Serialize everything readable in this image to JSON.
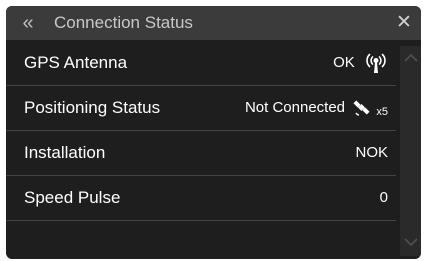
{
  "header": {
    "back_glyph": "«",
    "title": "Connection Status",
    "close_glyph": "✕"
  },
  "rows": [
    {
      "label": "GPS Antenna",
      "value": "OK",
      "icon": "antenna-signal-icon"
    },
    {
      "label": "Positioning Status",
      "value": "Not Connected",
      "icon": "satellite-icon",
      "suffix": "x5"
    },
    {
      "label": "Installation",
      "value": "NOK"
    },
    {
      "label": "Speed Pulse",
      "value": "0"
    }
  ],
  "scrollbar": {
    "up_icon": "chevron-up-icon",
    "down_icon": "chevron-down-icon"
  },
  "colors": {
    "background": "#1e1e1e",
    "header": "#3b3b3b",
    "text": "#ffffff",
    "divider": "#444444"
  }
}
